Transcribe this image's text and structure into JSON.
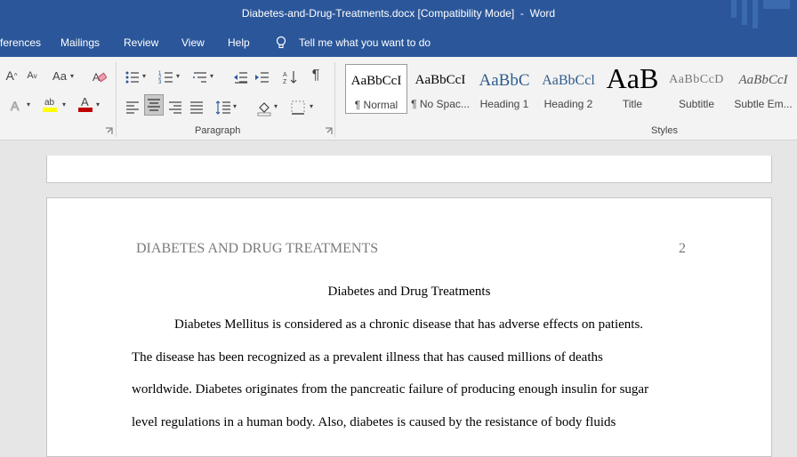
{
  "window": {
    "title": "Diabetes-and-Drug-Treatments.docx [Compatibility Mode]  -  Word"
  },
  "tabs": {
    "references": "ferences",
    "mailings": "Mailings",
    "review": "Review",
    "view": "View",
    "help": "Help",
    "tell_me": "Tell me what you want to do"
  },
  "ribbon": {
    "change_case_label": "Aa",
    "paragraph_group_label": "Paragraph",
    "styles_group_label": "Styles",
    "styles": [
      {
        "sample": "AaBbCcI",
        "name": "¶ Normal"
      },
      {
        "sample": "AaBbCcI",
        "name": "¶ No Spac..."
      },
      {
        "sample": "AaBbC",
        "name": "Heading 1"
      },
      {
        "sample": "AaBbCcl",
        "name": "Heading 2"
      },
      {
        "sample": "AaB",
        "name": "Title"
      },
      {
        "sample": "AaBbCcD",
        "name": "Subtitle"
      },
      {
        "sample": "AaBbCcI",
        "name": "Subtle Em..."
      }
    ],
    "colors": {
      "highlight": "#ffff00",
      "font_color": "#c00000"
    }
  },
  "document": {
    "running_head": "DIABETES AND DRUG TREATMENTS",
    "page_number": "2",
    "title": "Diabetes and Drug Treatments",
    "lines": [
      "Diabetes Mellitus is considered as a chronic disease that has adverse effects on patients.",
      "The disease has been recognized as a prevalent illness that has caused millions of deaths",
      "worldwide. Diabetes originates from the pancreatic failure of producing enough insulin for sugar",
      "level regulations in a human body. Also, diabetes is caused by the resistance of body fluids"
    ]
  },
  "colors": {
    "brand": "#2b579a",
    "ribbon_bg": "#f3f3f3",
    "canvas_bg": "#e6e6e6"
  }
}
